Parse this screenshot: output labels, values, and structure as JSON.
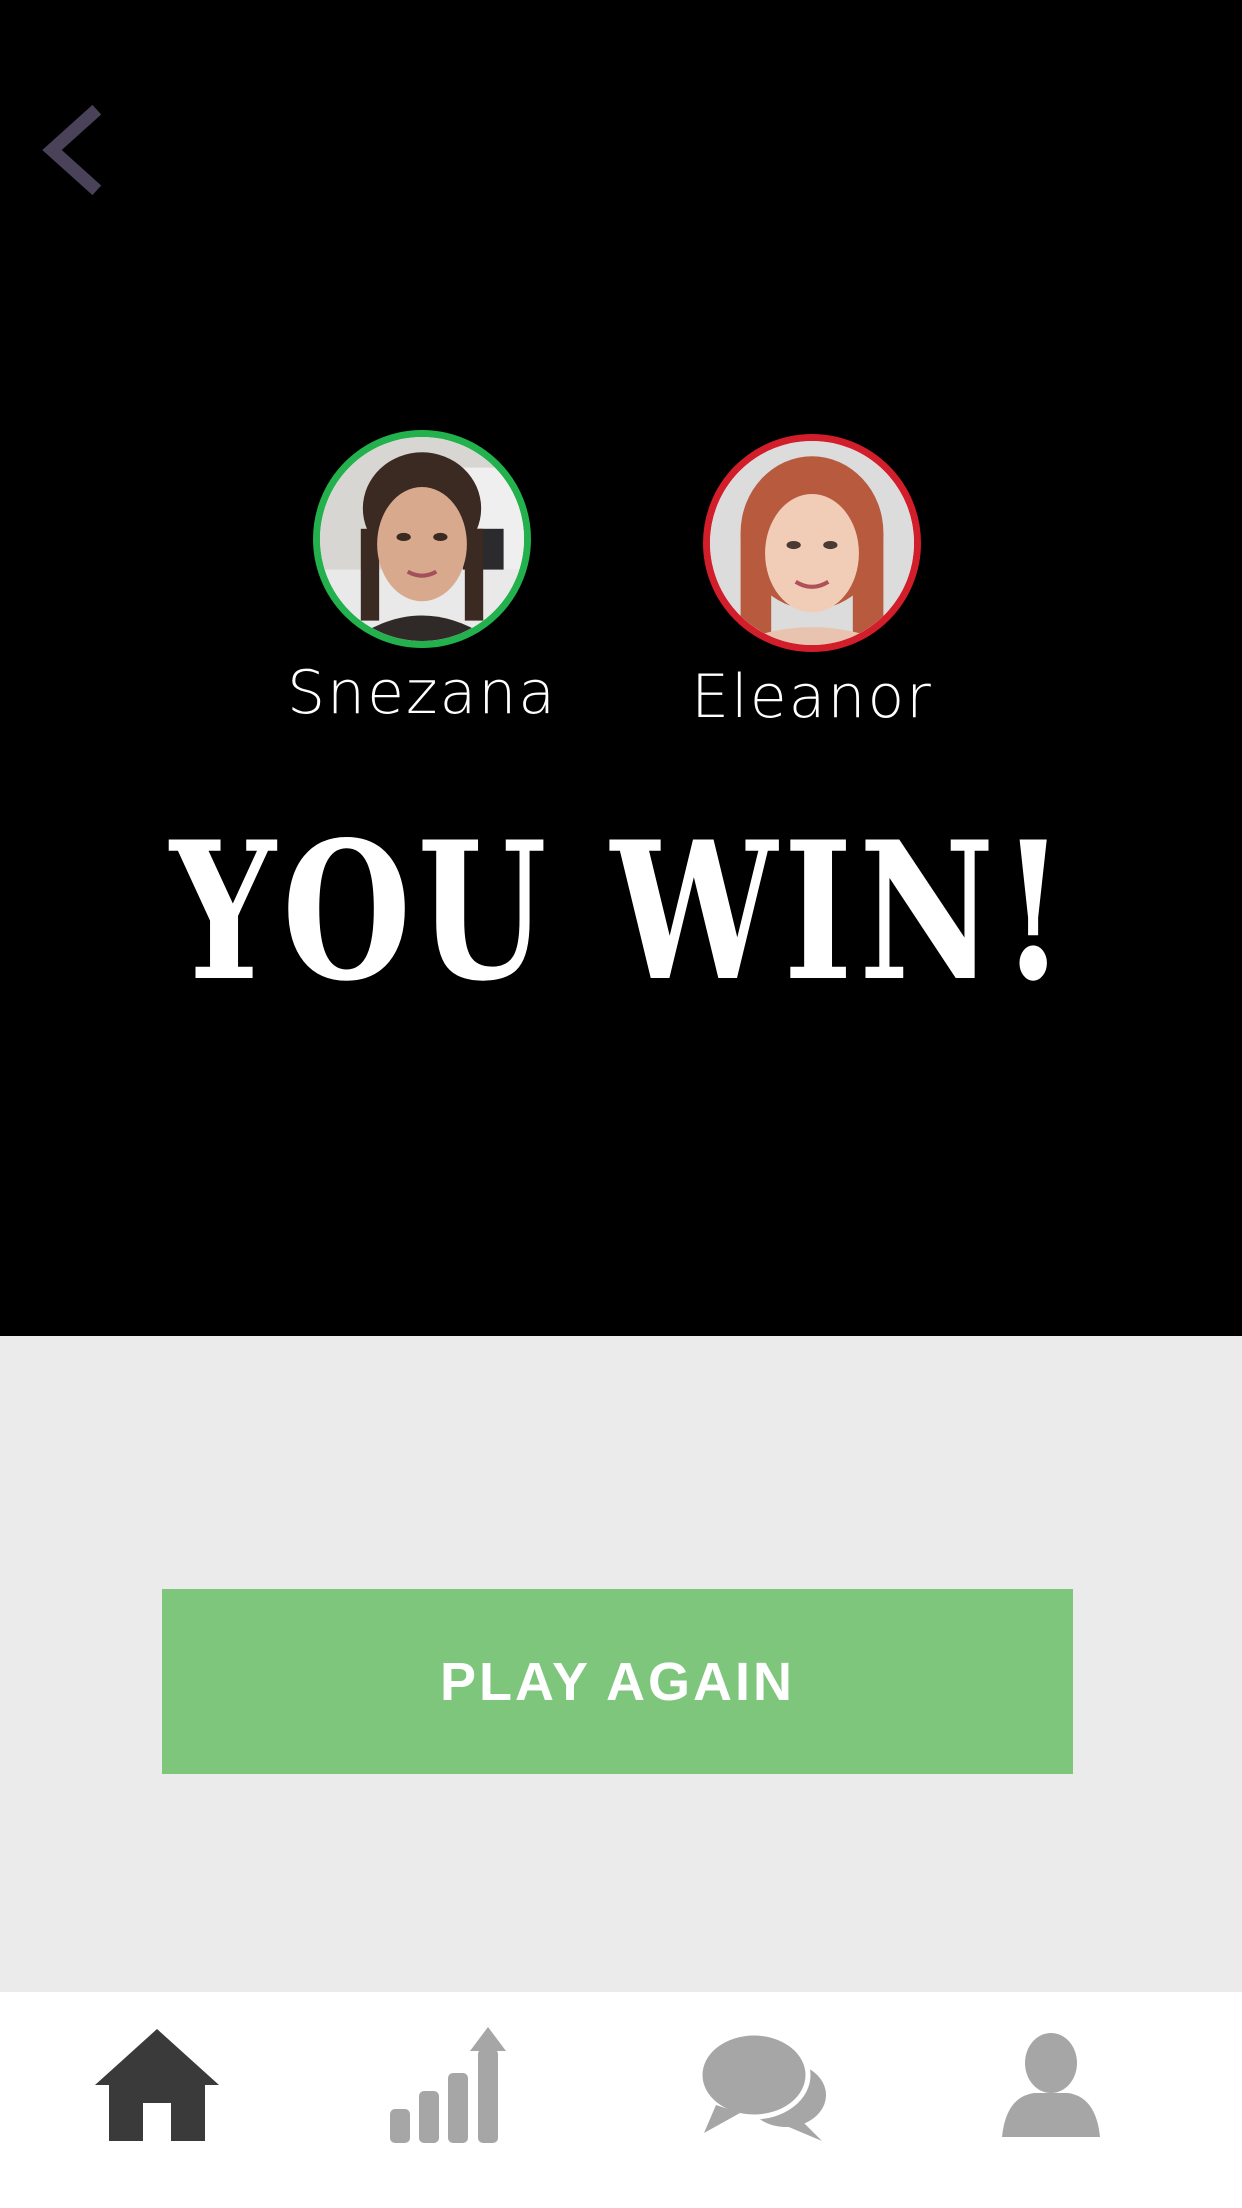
{
  "players": [
    {
      "name": "Snezana",
      "ring_color": "#22b14c"
    },
    {
      "name": "Eleanor",
      "ring_color": "#d21e2a"
    }
  ],
  "result_text": "YOU WIN!",
  "play_again_label": "PLAY AGAIN",
  "icons": {
    "back": "chevron-left-icon",
    "tabs": [
      "home-icon",
      "stats-icon",
      "chat-icon",
      "profile-icon"
    ]
  },
  "colors": {
    "top_background": "#000000",
    "bottom_background": "#ebebeb",
    "button": "#7dc67b",
    "active_tab": "#3a3a3a",
    "inactive_tab": "#a6a6a6",
    "back_chevron": "#4a4258"
  }
}
